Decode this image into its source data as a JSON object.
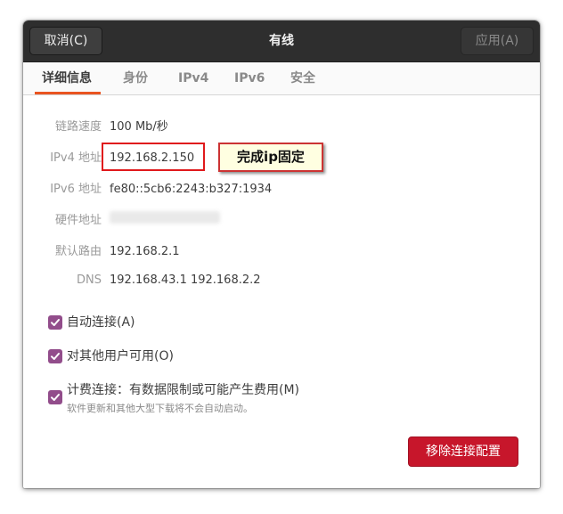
{
  "header": {
    "cancel_label": "取消(C)",
    "title": "有线",
    "apply_label": "应用(A)"
  },
  "tabs": [
    {
      "label": "详细信息",
      "active": true
    },
    {
      "label": "身份",
      "active": false
    },
    {
      "label": "IPv4",
      "active": false
    },
    {
      "label": "IPv6",
      "active": false
    },
    {
      "label": "安全",
      "active": false
    }
  ],
  "details": {
    "link_speed": {
      "label": "链路速度",
      "value": "100 Mb/秒"
    },
    "ipv4": {
      "label": "IPv4 地址",
      "value": "192.168.2.150"
    },
    "ipv6": {
      "label": "IPv6 地址",
      "value": "fe80::5cb6:2243:b327:1934"
    },
    "hardware": {
      "label": "硬件地址"
    },
    "default_route": {
      "label": "默认路由",
      "value": "192.168.2.1"
    },
    "dns": {
      "label": "DNS",
      "value": "192.168.43.1 192.168.2.2"
    }
  },
  "annotation": {
    "note": "完成ip固定"
  },
  "options": {
    "auto_connect": {
      "label": "自动连接(A)",
      "checked": true
    },
    "all_users": {
      "label": "对其他用户可用(O)",
      "checked": true
    },
    "metered": {
      "label": "计费连接：有数据限制或可能产生费用(M)",
      "checked": true
    },
    "metered_hint": "软件更新和其他大型下载将不会自动启动。"
  },
  "actions": {
    "remove_label": "移除连接配置"
  },
  "colors": {
    "accent_tab": "#e95420",
    "checkbox": "#924d8b",
    "destructive": "#c7162b",
    "callout_border": "#e0191c",
    "callout_fill": "#ffffe1"
  }
}
